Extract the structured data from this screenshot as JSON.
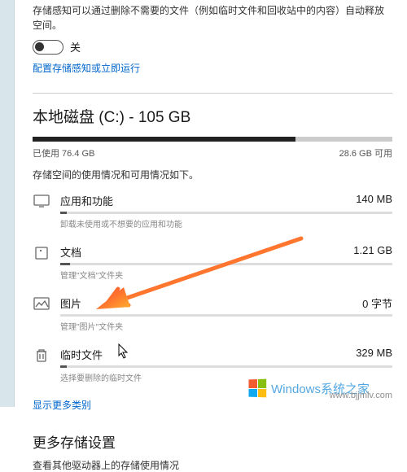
{
  "top": {
    "desc": "存储感知可以通过删除不需要的文件（例如临时文件和回收站中的内容）自动释放空间。",
    "toggle_state": "off",
    "toggle_label": "关",
    "config_link": "配置存储感知或立即运行"
  },
  "disk": {
    "title": "本地磁盘 (C:) - 105 GB",
    "used_label": "已使用 76.4 GB",
    "free_label": "28.6 GB 可用",
    "used_pct": 73
  },
  "usage_desc": "存储空间的使用情况和可用情况如下。",
  "categories": [
    {
      "icon": "apps",
      "name": "应用和功能",
      "size": "140 MB",
      "sub": "卸载未使用或不想要的应用和功能",
      "fill_pct": 2
    },
    {
      "icon": "doc",
      "name": "文档",
      "size": "1.21 GB",
      "sub": "管理\"文档\"文件夹",
      "fill_pct": 3
    },
    {
      "icon": "image",
      "name": "图片",
      "size": "0 字节",
      "sub": "管理\"图片\"文件夹",
      "fill_pct": 0
    },
    {
      "icon": "trash",
      "name": "临时文件",
      "size": "329 MB",
      "sub": "选择要删除的临时文件",
      "fill_pct": 2
    }
  ],
  "more_link": "显示更多类别",
  "section2_title": "更多存储设置",
  "bottom_desc": "查看其他驱动器上的存储使用情况",
  "watermark": {
    "main": "Windows系统之家",
    "sub": "www.bjjmlv.com"
  }
}
